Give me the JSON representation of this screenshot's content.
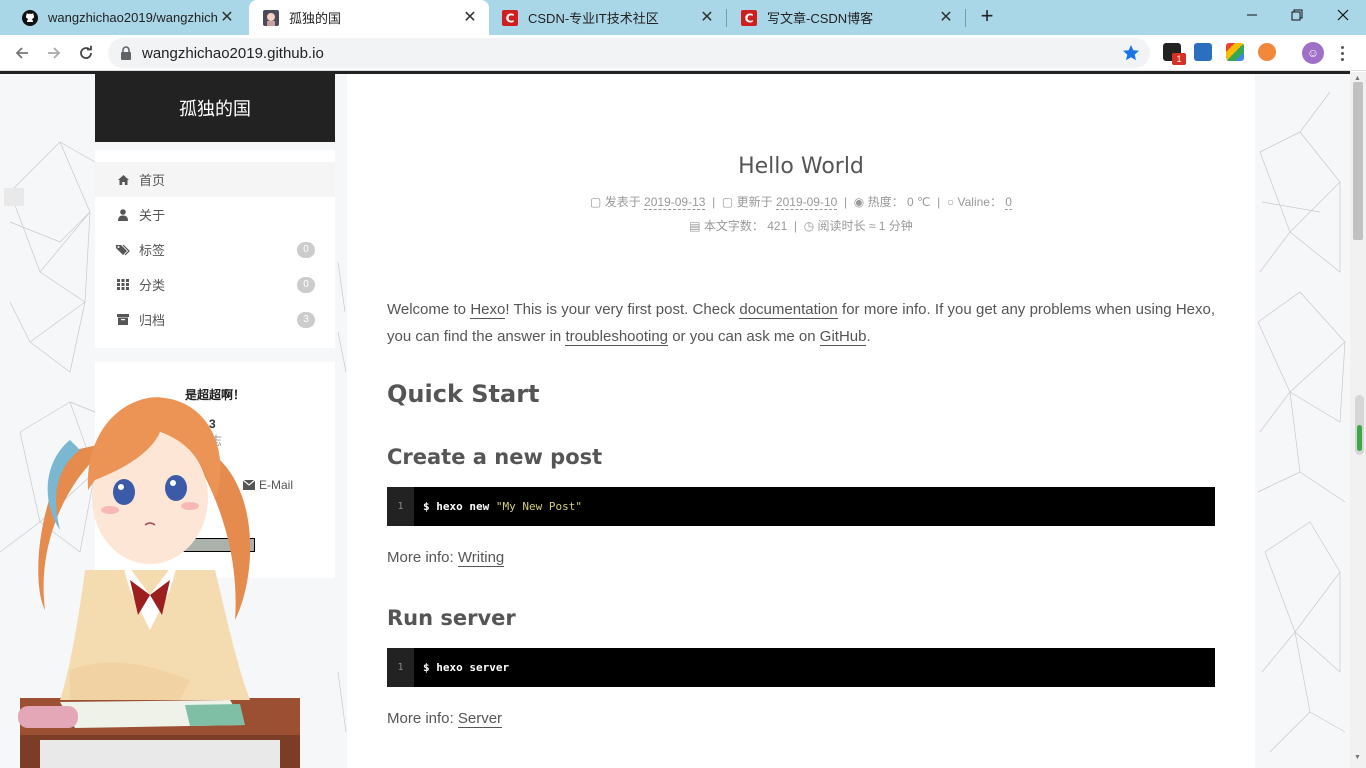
{
  "browser": {
    "tabs": [
      {
        "title": "wangzhichao2019/wangzhicha",
        "icon": "github-icon"
      },
      {
        "title": "孤独的国",
        "icon": "site-avatar-icon",
        "active": true
      },
      {
        "title": "CSDN-专业IT技术社区",
        "icon": "csdn-icon"
      },
      {
        "title": "写文章-CSDN博客",
        "icon": "csdn-icon"
      }
    ],
    "url": "wangzhichao2019.github.io",
    "extension_badge": "1"
  },
  "sidebar": {
    "site_title": "孤独的国",
    "nav": [
      {
        "label": "首页",
        "icon": "home-icon"
      },
      {
        "label": "关于",
        "icon": "user-icon"
      },
      {
        "label": "标签",
        "icon": "tags-icon",
        "count": "0"
      },
      {
        "label": "分类",
        "icon": "grid-icon",
        "count": "0"
      },
      {
        "label": "归档",
        "icon": "archive-icon",
        "count": "3"
      }
    ],
    "author": {
      "name": "是超超啊！",
      "stat_value": "3",
      "stat_label": "志",
      "email": "E-Mail",
      "misc": "o"
    }
  },
  "post": {
    "title": "Hello World",
    "meta1": {
      "posted_label": "发表于",
      "posted_date": "2019-09-13",
      "updated_label": "更新于",
      "updated_date": "2019-09-10",
      "heat": "热度：  0 ℃",
      "valine_label": "Valine：",
      "valine_count": "0"
    },
    "meta2": {
      "words": "本文字数：  421",
      "reading": "阅读时长 ≈ 1 分钟"
    },
    "intro": {
      "t1": "Welcome to ",
      "hexo": "Hexo",
      "t2": "! This is your very first post. Check ",
      "documentation": "documentation",
      "t3": " for more info. If you get any problems when using Hexo, you can find the answer in ",
      "troubleshooting": "troubleshooting",
      "t4": " or you can ask me on ",
      "github": "GitHub",
      "t5": "."
    },
    "h_quick": "Quick Start",
    "h_create": "Create a new post",
    "code1": {
      "num": "1",
      "cmd": "$ hexo new ",
      "arg": "\"My New Post\""
    },
    "more1": {
      "label": "More info: ",
      "link": "Writing"
    },
    "h_run": "Run server",
    "code2": {
      "num": "1",
      "cmd": "$ hexo server"
    },
    "more2": {
      "label": "More info: ",
      "link": "Server"
    }
  }
}
